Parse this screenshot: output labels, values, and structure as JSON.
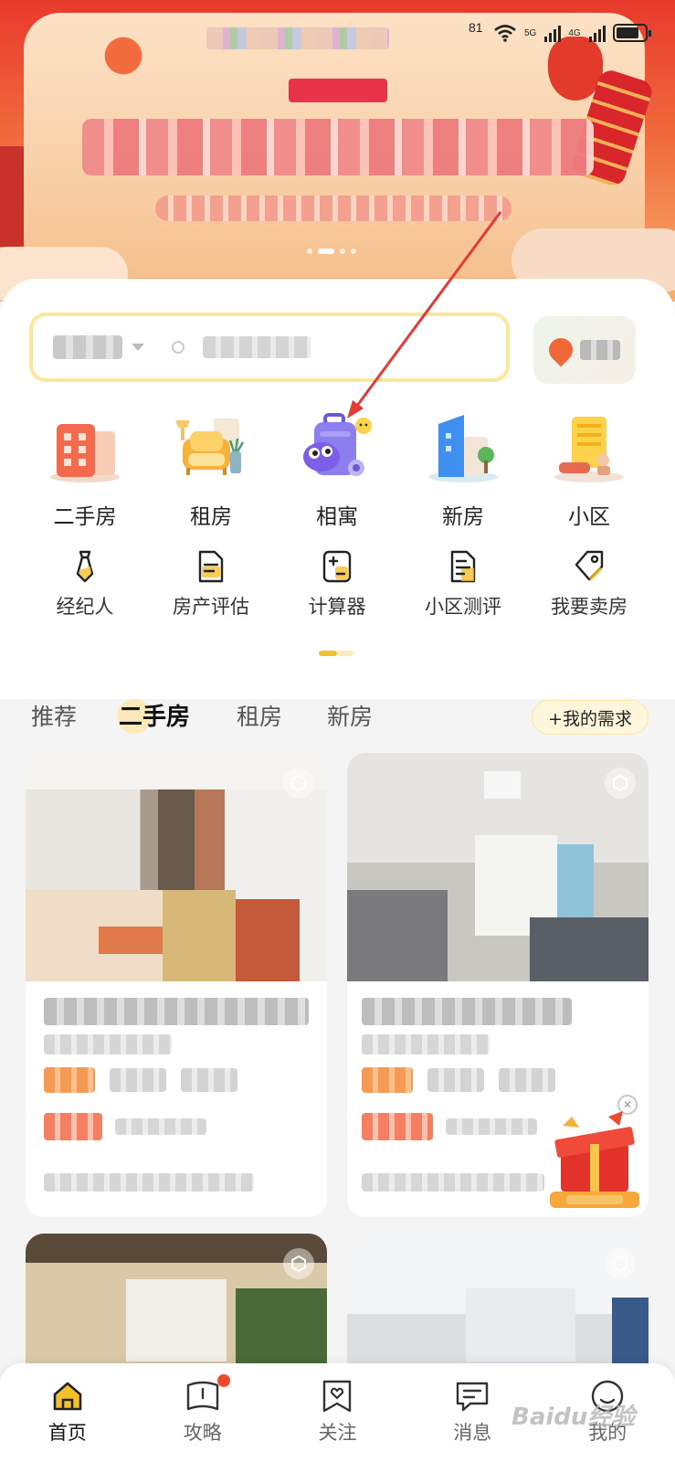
{
  "status_bar": {
    "time": "81",
    "net_label_1": "5G",
    "net_label_2": "4G"
  },
  "categories": [
    {
      "label": "二手房",
      "icon": "building-icon"
    },
    {
      "label": "租房",
      "icon": "sofa-icon"
    },
    {
      "label": "相寓",
      "icon": "luggage-mascot-icon"
    },
    {
      "label": "新房",
      "icon": "new-building-icon"
    },
    {
      "label": "小区",
      "icon": "community-icon"
    }
  ],
  "tools": [
    {
      "label": "经纪人",
      "icon": "agent-tie-icon"
    },
    {
      "label": "房产评估",
      "icon": "document-icon"
    },
    {
      "label": "计算器",
      "icon": "calculator-icon"
    },
    {
      "label": "小区测评",
      "icon": "review-doc-icon"
    },
    {
      "label": "我要卖房",
      "icon": "price-tag-icon"
    }
  ],
  "tabs": [
    {
      "label": "推荐",
      "active": false
    },
    {
      "label": "二手房",
      "active": true
    },
    {
      "label": "租房",
      "active": false
    },
    {
      "label": "新房",
      "active": false
    }
  ],
  "need_button": "+我的需求",
  "bottom_nav": [
    {
      "label": "首页",
      "icon": "home-icon",
      "active": true
    },
    {
      "label": "攻略",
      "icon": "guide-book-icon",
      "active": false,
      "badge": true
    },
    {
      "label": "关注",
      "icon": "heart-bookmark-icon",
      "active": false
    },
    {
      "label": "消息",
      "icon": "message-icon",
      "active": false
    },
    {
      "label": "我的",
      "icon": "profile-icon",
      "active": false
    }
  ],
  "watermark": "Baidu经验",
  "colors": {
    "accent": "#f5c12b",
    "brand_orange": "#f08a3a",
    "badge_red": "#ee4a2e",
    "annotation_arrow": "#e53935"
  }
}
